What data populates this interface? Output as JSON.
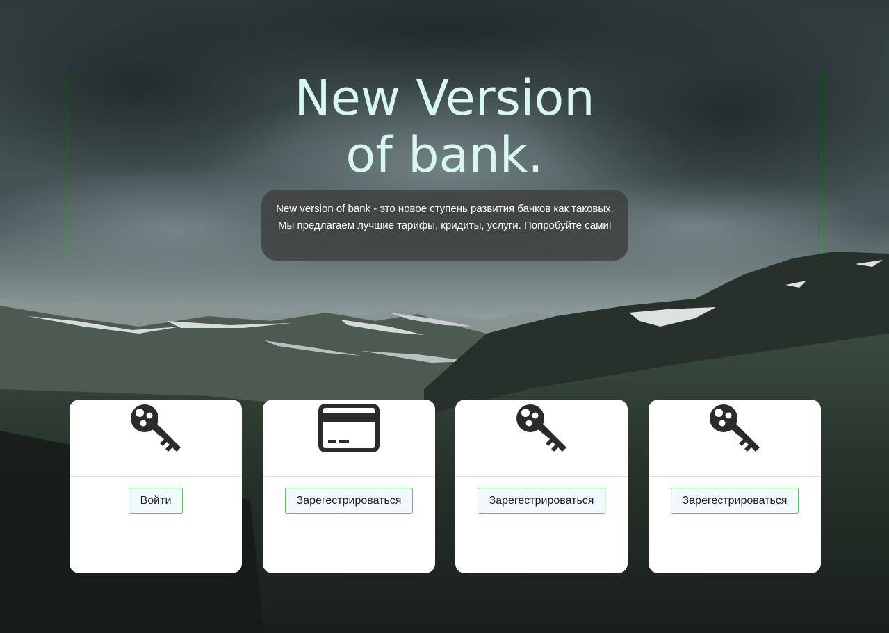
{
  "hero": {
    "title_line1": "New Version",
    "title_line2": "of bank.",
    "description": "New version of bank - это новое ступень развития банков как таковых. Мы предлагаем лучшие тарифы, кридиты, услуги. Попробуйте сами!"
  },
  "cards": [
    {
      "icon": "key-icon",
      "button_label": "Войти"
    },
    {
      "icon": "credit-card-icon",
      "button_label": "Зарегестрироваться"
    },
    {
      "icon": "key-icon",
      "button_label": "Зарегестрироваться"
    },
    {
      "icon": "key-icon",
      "button_label": "Зарегестрироваться"
    }
  ],
  "colors": {
    "title": "#d8f8ee",
    "accent_line": "#6fc76a",
    "button_border": "#63b86a",
    "button_bg": "#f2f9fd",
    "description_bg": "#3e3e3e"
  }
}
